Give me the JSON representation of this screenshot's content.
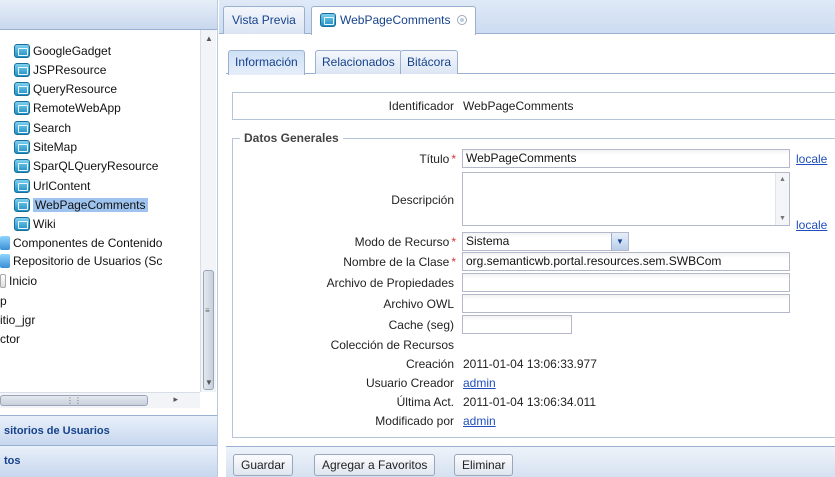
{
  "tree": {
    "items": [
      {
        "label": "GoogleGadget",
        "icon": "resource-icon"
      },
      {
        "label": "JSPResource",
        "icon": "resource-icon"
      },
      {
        "label": "QueryResource",
        "icon": "resource-icon"
      },
      {
        "label": "RemoteWebApp",
        "icon": "resource-icon"
      },
      {
        "label": "Search",
        "icon": "resource-icon"
      },
      {
        "label": "SiteMap",
        "icon": "resource-icon"
      },
      {
        "label": "SparQLQueryResource",
        "icon": "resource-icon"
      },
      {
        "label": "UrlContent",
        "icon": "resource-icon"
      },
      {
        "label": "WebPageComments",
        "icon": "resource-icon",
        "selected": true
      },
      {
        "label": "Wiki",
        "icon": "resource-icon"
      },
      {
        "label": "Componentes de Contenido",
        "icon": "folder-icon"
      },
      {
        "label": "Repositorio de Usuarios (Sc",
        "icon": "folder-icon"
      },
      {
        "label": "Inicio",
        "icon": "page-icon"
      },
      {
        "label": "p",
        "icon": ""
      },
      {
        "label": "itio_jgr",
        "icon": ""
      },
      {
        "label": "ctor",
        "icon": ""
      }
    ]
  },
  "accordion": {
    "users": "sitorios de Usuarios",
    "second": "tos"
  },
  "top_tabs": {
    "preview": "Vista Previa",
    "current": "WebPageComments"
  },
  "inner_tabs": {
    "info": "Información",
    "related": "Relacionados",
    "log": "Bitácora"
  },
  "form": {
    "identifier_label": "Identificador",
    "identifier_value": "WebPageComments",
    "section_title": "Datos Generales",
    "title_label": "Título",
    "title_value": "WebPageComments",
    "locale_link": "locale",
    "description_label": "Descripción",
    "description_value": "",
    "mode_label": "Modo de Recurso",
    "mode_value": "Sistema",
    "class_label": "Nombre de la Clase",
    "class_value": "org.semanticwb.portal.resources.sem.SWBCom",
    "props_label": "Archivo de Propiedades",
    "props_value": "",
    "owl_label": "Archivo OWL",
    "owl_value": "",
    "cache_label": "Cache (seg)",
    "cache_value": "",
    "collection_label": "Colección de Recursos",
    "creation_label": "Creación",
    "creation_value": "2011-01-04 13:06:33.977",
    "creator_label": "Usuario Creador",
    "creator_value": "admin",
    "lastact_label": "Última Act.",
    "lastact_value": "2011-01-04 13:06:34.011",
    "modifier_label": "Modificado por",
    "modifier_value": "admin",
    "required_mark": "*"
  },
  "toolbar": {
    "save": "Guardar",
    "favorites": "Agregar a Favoritos",
    "delete": "Eliminar"
  },
  "colors": {
    "accent": "#15428b",
    "link": "#1f4fbf",
    "selection": "#9fc3ef"
  }
}
